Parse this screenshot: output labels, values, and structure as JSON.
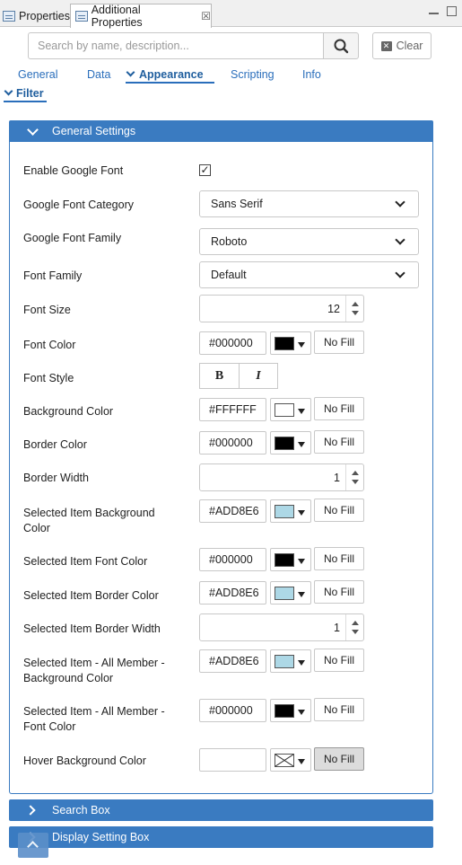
{
  "window_tabs": [
    {
      "label": "Properties"
    },
    {
      "label": "Additional Properties",
      "close": "☒"
    }
  ],
  "search": {
    "placeholder": "Search by name, description...",
    "value": "",
    "clear_label": "Clear"
  },
  "prop_tabs": [
    "General",
    "Data",
    "Appearance",
    "Scripting",
    "Info"
  ],
  "active_tab": "Appearance",
  "sub_tab": "Filter",
  "panels": {
    "general": "General Settings",
    "search_box": "Search Box",
    "display_setting": "Display Setting Box"
  },
  "fields": {
    "enable_google_font": {
      "label": "Enable Google Font",
      "checked": true,
      "check_glyph": "✓"
    },
    "google_font_category": {
      "label": "Google Font Category",
      "value": "Sans Serif"
    },
    "google_font_family": {
      "label": "Google Font Family",
      "value": "Roboto"
    },
    "font_family": {
      "label": "Font Family",
      "value": "Default"
    },
    "font_size": {
      "label": "Font Size",
      "value": "12"
    },
    "font_color": {
      "label": "Font Color",
      "hex": "#000000",
      "swatch": "#000000",
      "nofill": "No Fill"
    },
    "font_style": {
      "label": "Font Style",
      "bold": "B",
      "italic": "I"
    },
    "background_color": {
      "label": "Background Color",
      "hex": "#FFFFFF",
      "swatch": "#FFFFFF",
      "nofill": "No Fill"
    },
    "border_color": {
      "label": "Border Color",
      "hex": "#000000",
      "swatch": "#000000",
      "nofill": "No Fill"
    },
    "border_width": {
      "label": "Border Width",
      "value": "1"
    },
    "sel_bg_color": {
      "label": "Selected Item Background Color",
      "hex": "#ADD8E6",
      "swatch": "#ADD8E6",
      "nofill": "No Fill"
    },
    "sel_font_color": {
      "label": "Selected Item Font Color",
      "hex": "#000000",
      "swatch": "#000000",
      "nofill": "No Fill"
    },
    "sel_border_color": {
      "label": "Selected Item Border Color",
      "hex": "#ADD8E6",
      "swatch": "#ADD8E6",
      "nofill": "No Fill"
    },
    "sel_border_width": {
      "label": "Selected Item Border Width",
      "value": "1"
    },
    "all_bg_color": {
      "label": "Selected Item - All Member - Background Color",
      "hex": "#ADD8E6",
      "swatch": "#ADD8E6",
      "nofill": "No Fill"
    },
    "all_font_color": {
      "label": "Selected Item - All Member - Font Color",
      "hex": "#000000",
      "swatch": "#000000",
      "nofill": "No Fill"
    },
    "hover_bg_color": {
      "label": "Hover Background Color",
      "hex": "",
      "swatch": "none",
      "nofill": "No Fill"
    }
  },
  "colors": {
    "accent": "#3A7BC1",
    "link": "#2A6EBB"
  },
  "icons": {
    "search": "search-icon",
    "clear": "clear-icon",
    "close": "close-icon",
    "scroll_top": "chevron-up-icon"
  }
}
